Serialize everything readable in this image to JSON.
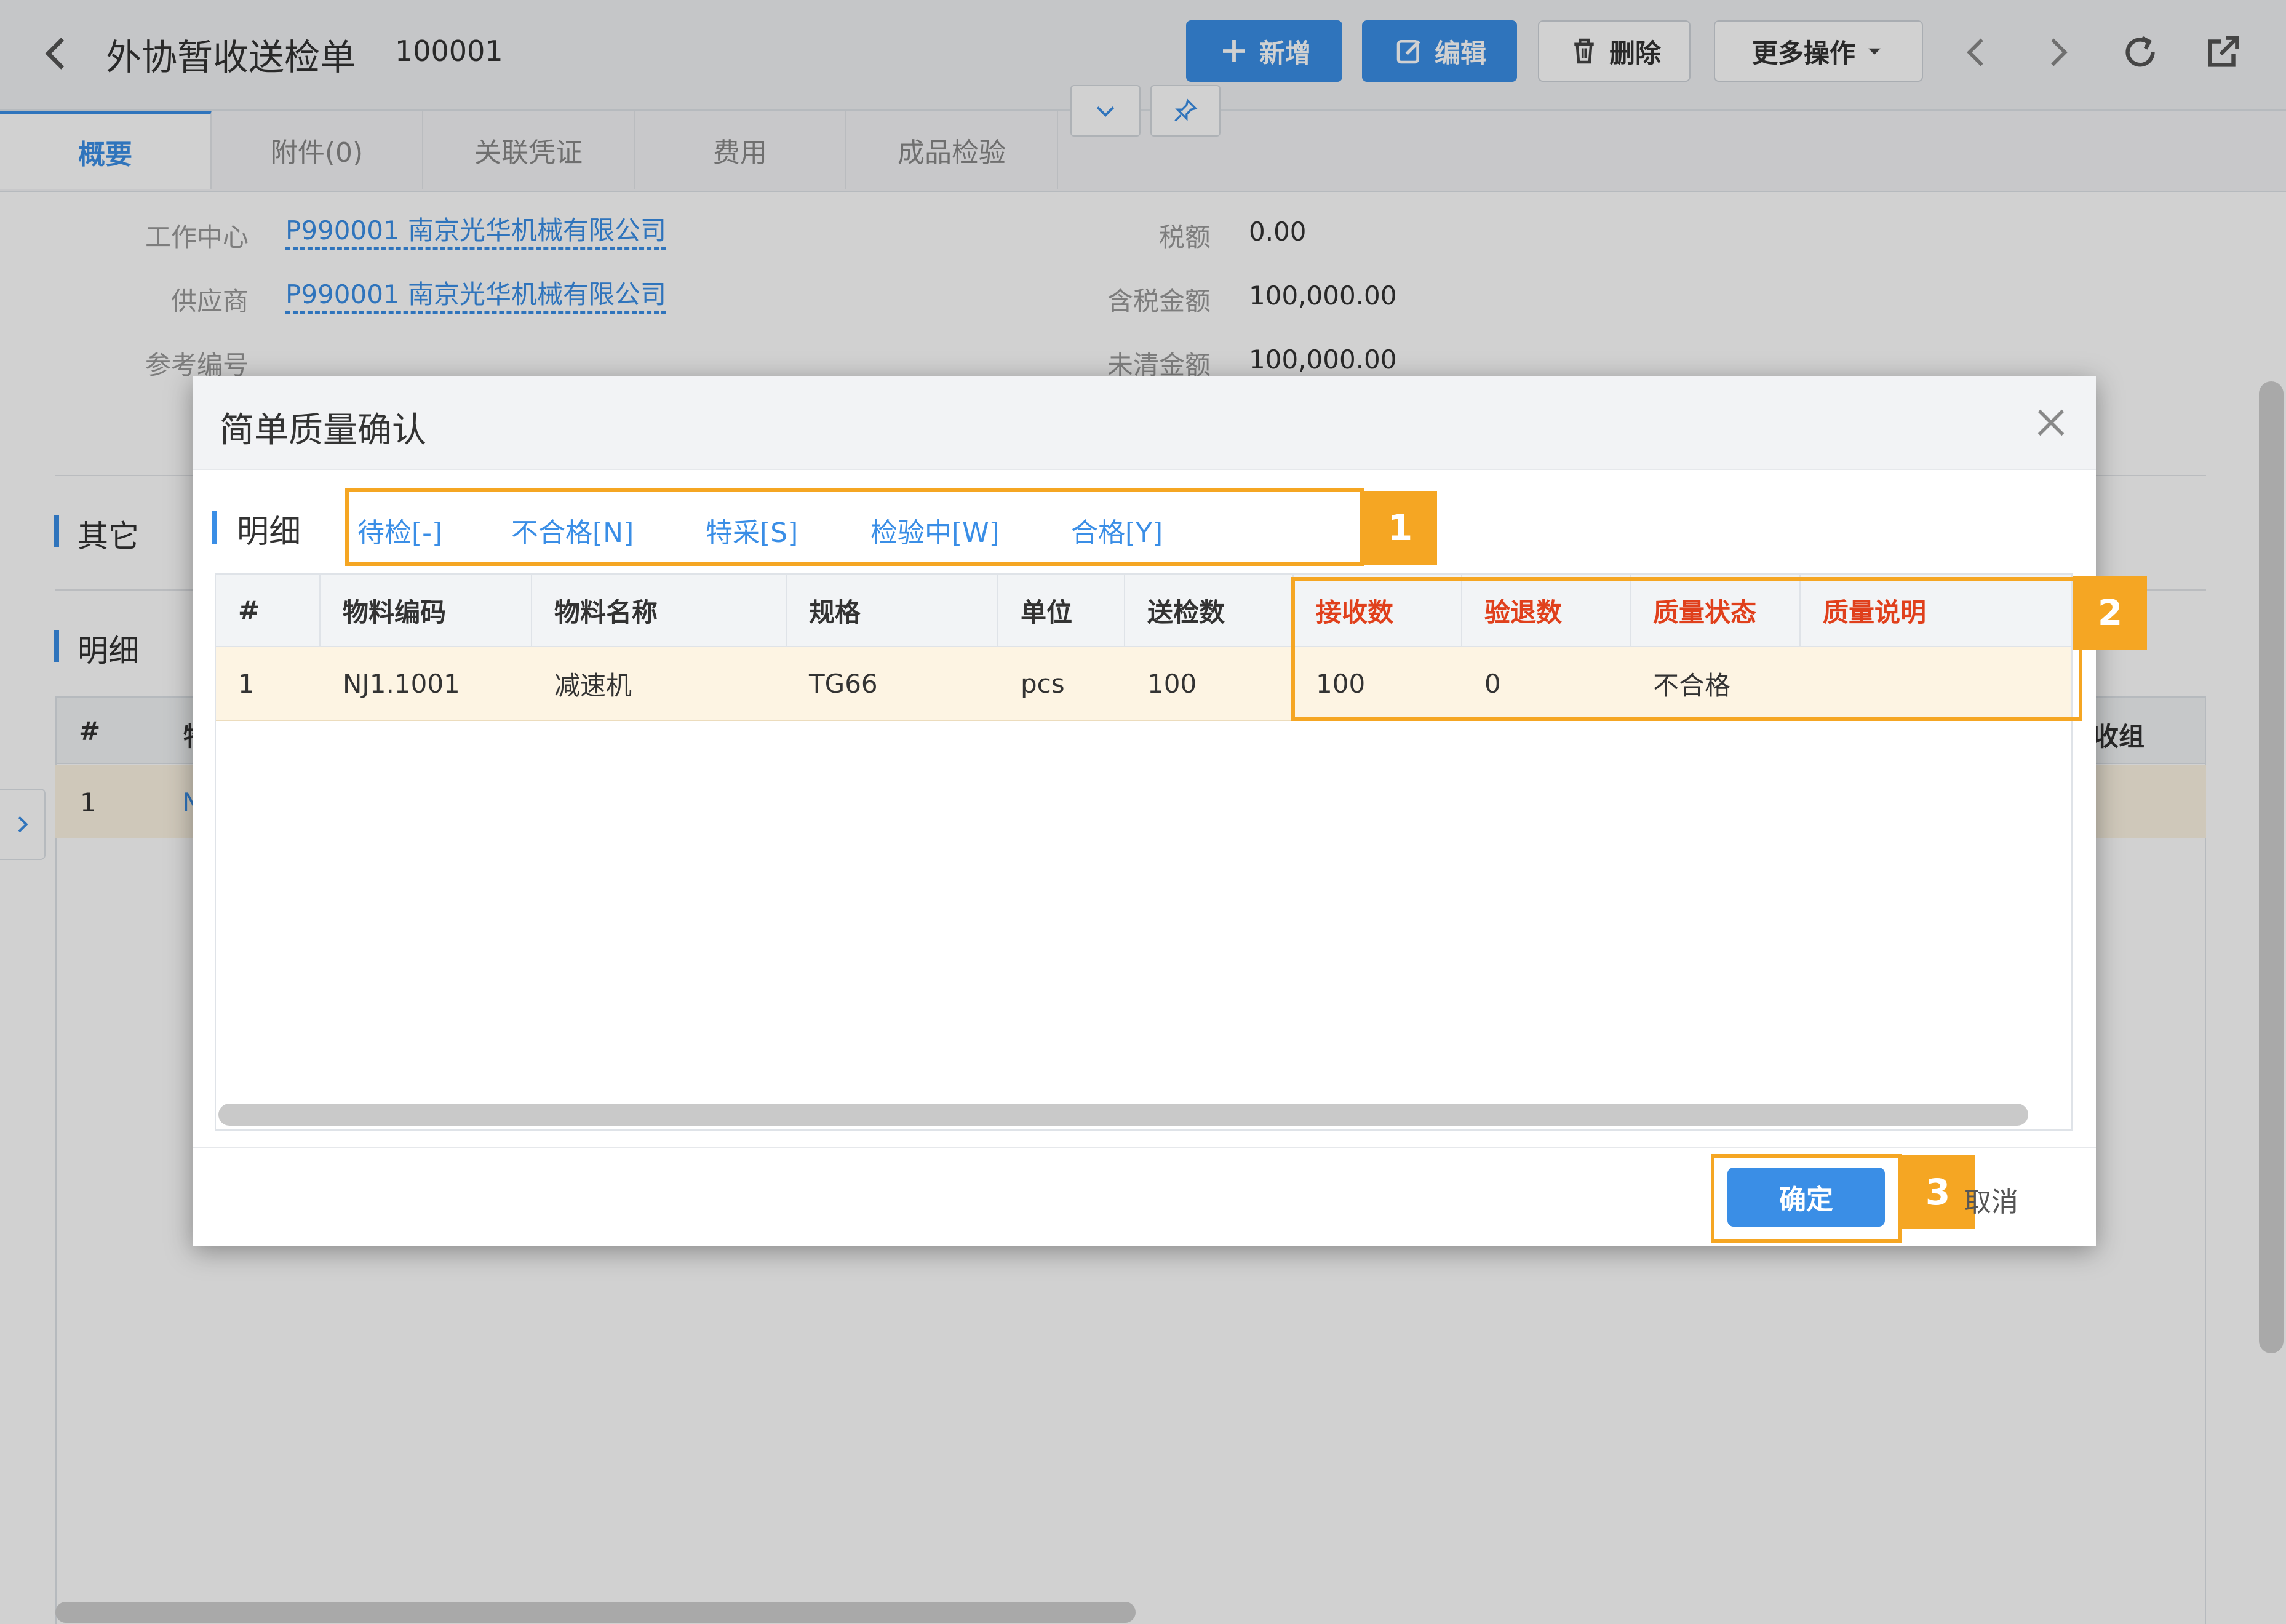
{
  "page": {
    "title": "外协暂收送检单",
    "code": "100001",
    "toolbar": {
      "add": "新增",
      "edit": "编辑",
      "delete": "删除",
      "more": "更多操作"
    },
    "tabs": [
      "概要",
      "附件(0)",
      "关联凭证",
      "费用",
      "成品检验"
    ],
    "fields": {
      "work_center_label": "工作中心",
      "work_center_value": "P990001 南京光华机械有限公司",
      "supplier_label": "供应商",
      "supplier_value": "P990001 南京光华机械有限公司",
      "ref_no_label": "参考编号",
      "tax_label": "税额",
      "tax_value": "0.00",
      "tax_incl_label": "含税金额",
      "tax_incl_value": "100,000.00",
      "uncleared_label": "未清金额",
      "uncleared_value": "100,000.00"
    },
    "sections": {
      "other": "其它",
      "detail": "明细"
    },
    "bg_table": {
      "hash": "#",
      "partial_header": "物",
      "right_header": "收组",
      "row_index": "1",
      "row_partial": "N"
    }
  },
  "modal": {
    "title": "简单质量确认",
    "detail_label": "明细",
    "filters": [
      "待检[-]",
      "不合格[N]",
      "特采[S]",
      "检验中[W]",
      "合格[Y]"
    ],
    "columns": [
      "#",
      "物料编码",
      "物料名称",
      "规格",
      "单位",
      "送检数",
      "接收数",
      "验退数",
      "质量状态",
      "质量说明"
    ],
    "row": {
      "index": "1",
      "material_code": "NJ1.1001",
      "material_name": "减速机",
      "spec": "TG66",
      "unit": "pcs",
      "sent_qty": "100",
      "received_qty": "100",
      "returned_qty": "0",
      "quality_status": "不合格",
      "quality_note": ""
    },
    "ok_label": "确定",
    "cancel_label": "取消"
  },
  "callouts": [
    "1",
    "2",
    "3"
  ],
  "colors": {
    "accent": "#3a8ee6",
    "callout": "#f5a623",
    "required_header": "#e0401c",
    "row_highlight": "#fdf4e3"
  }
}
